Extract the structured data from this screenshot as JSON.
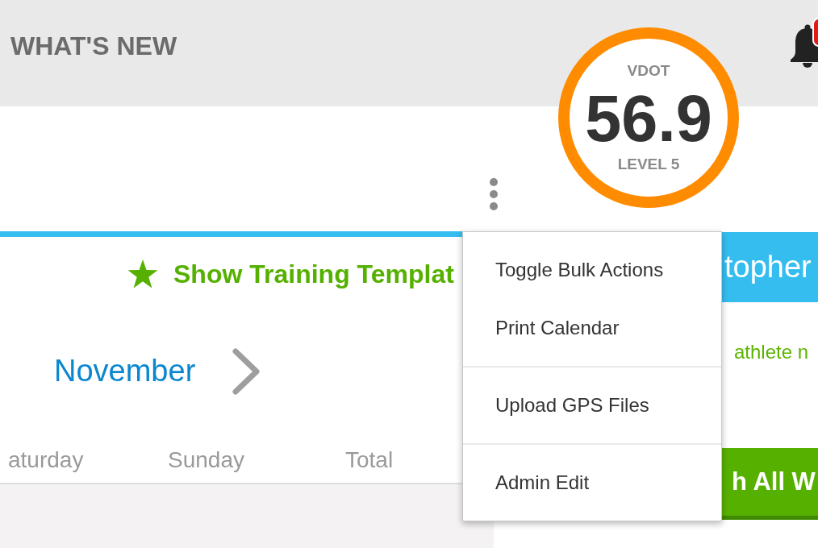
{
  "header": {
    "title": "WHAT'S NEW"
  },
  "vdot": {
    "label": "VDOT",
    "value": "56.9",
    "caption": "LEVEL 5"
  },
  "calendar": {
    "templates_link": "Show Training Templat",
    "month": "November",
    "day_headers": [
      "aturday",
      "Sunday",
      "Total"
    ]
  },
  "athlete_panel": {
    "name": "topher",
    "note": "athlete n",
    "action_button": "h All W"
  },
  "menu": {
    "groups": [
      {
        "items": [
          "Toggle Bulk Actions",
          "Print Calendar"
        ]
      },
      {
        "items": [
          "Upload GPS Files"
        ]
      },
      {
        "items": [
          "Admin Edit"
        ]
      }
    ]
  }
}
